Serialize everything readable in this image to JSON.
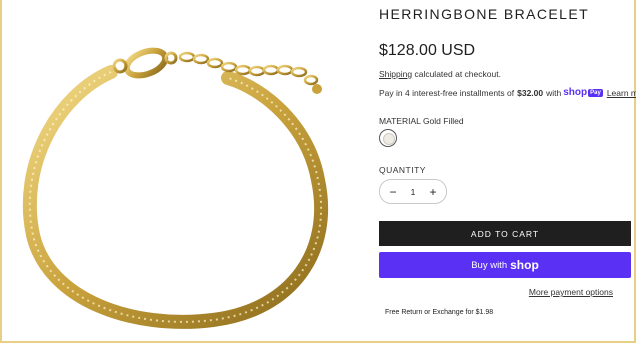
{
  "product": {
    "title": "HERRINGBONE BRACELET",
    "price": "$128.00 USD",
    "image_alt": "Gold herringbone chain bracelet with lobster clasp"
  },
  "shipping": {
    "link_text": "Shipping",
    "rest_text": "calculated at checkout."
  },
  "installments": {
    "prefix": "Pay in 4 interest-free installments of",
    "amount": "$32.00",
    "with": "with",
    "brand": "shop",
    "badge": "Pay",
    "learn_more": "Learn more"
  },
  "material": {
    "label": "MATERIAL",
    "value": "Gold Filled"
  },
  "quantity": {
    "label": "QUANTITY",
    "value": "1",
    "minus": "−",
    "plus": "+"
  },
  "actions": {
    "add_to_cart": "ADD TO CART",
    "buy_with": "Buy with",
    "buy_brand": "shop",
    "more_payment": "More payment options"
  },
  "footer_note": "Free Return or Exchange for $1.98",
  "colors": {
    "frame_border": "#e7cf86",
    "cart_button": "#1f1f1f",
    "shop_purple": "#5a31f4",
    "gold": "#c9a23c"
  }
}
